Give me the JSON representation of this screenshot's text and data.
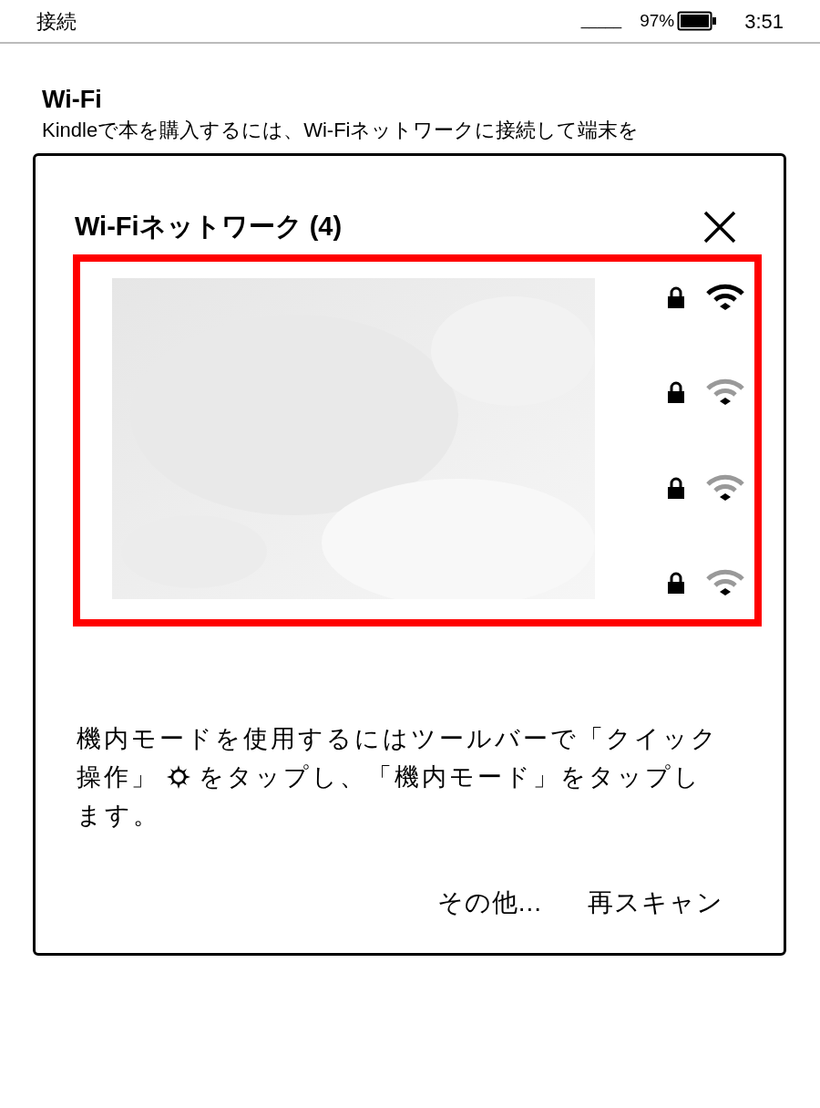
{
  "status_bar": {
    "title": "接続",
    "signal": "_____",
    "battery": "97%",
    "time": "3:51"
  },
  "section": {
    "heading": "Wi-Fi",
    "description": "Kindleで本を購入するには、Wi-Fiネットワークに接続して端末を"
  },
  "dialog": {
    "title": "Wi-Fiネットワーク (4)",
    "networks": [
      {
        "locked": true,
        "connected": true
      },
      {
        "locked": true,
        "connected": false
      },
      {
        "locked": true,
        "connected": false
      },
      {
        "locked": true,
        "connected": false
      }
    ],
    "note": {
      "line_1": "機内モードを使用するにはツールバーで「クイック",
      "line_2_before": "操作」",
      "line_2_after": "をタップし、「機内モード」をタップし",
      "line_3": "ます。"
    },
    "buttons": [
      "その他...",
      "再スキャン"
    ]
  }
}
